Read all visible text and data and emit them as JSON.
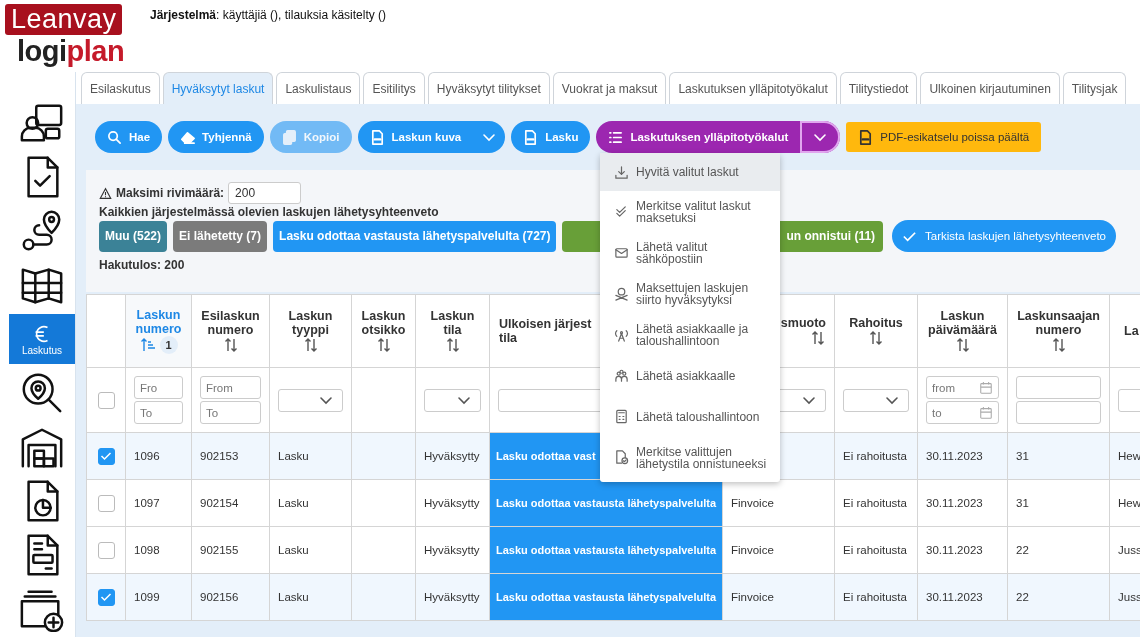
{
  "logo": {
    "brand": "Leanvay",
    "product_start": "logi",
    "product_end": "plan"
  },
  "header": {
    "text": "**Järjestelmä**: käyttäjiä (), tilauksia käsitelty ()"
  },
  "sidebar": {
    "items": [
      {
        "kind": "presenter",
        "selected": false
      },
      {
        "kind": "document-check",
        "selected": false
      },
      {
        "kind": "route",
        "selected": false
      },
      {
        "kind": "map",
        "selected": false
      },
      {
        "kind": "euro",
        "label": "Laskutus",
        "selected": true
      },
      {
        "kind": "search-pin",
        "selected": false
      },
      {
        "kind": "warehouse",
        "selected": false
      },
      {
        "kind": "document-chart",
        "selected": false
      },
      {
        "kind": "document-form",
        "selected": false
      },
      {
        "kind": "folder-plus",
        "selected": false
      }
    ]
  },
  "tabs": [
    {
      "label": "Esilaskutus",
      "selected": false
    },
    {
      "label": "Hyväksytyt laskut",
      "selected": true
    },
    {
      "label": "Laskulistaus",
      "selected": false
    },
    {
      "label": "Esitilitys",
      "selected": false
    },
    {
      "label": "Hyväksytyt tilitykset",
      "selected": false
    },
    {
      "label": "Vuokrat ja maksut",
      "selected": false
    },
    {
      "label": "Laskutuksen ylläpitotyökalut",
      "selected": false
    },
    {
      "label": "Tilitystiedot",
      "selected": false
    },
    {
      "label": "Ulkoinen kirjautuminen",
      "selected": false
    },
    {
      "label": "Tilitysjak",
      "selected": false
    }
  ],
  "toolbar": {
    "buttons": [
      {
        "label": "Hae",
        "kind": "search",
        "disabled": false
      },
      {
        "label": "Tyhjennä",
        "kind": "clear",
        "disabled": false
      },
      {
        "label": "Kopioi",
        "kind": "copy",
        "disabled": true
      },
      {
        "label": "Laskun kuva",
        "kind": "image",
        "disabled": false
      },
      {
        "label": "Lasku",
        "kind": "invoice",
        "disabled": false
      },
      {
        "label": "Laskutuksen ylläpitotyökalut",
        "kind": "tools",
        "disabled": false
      },
      {
        "label": "PDF-esikatselu poissa päältä",
        "kind": "preview",
        "disabled": false
      }
    ]
  },
  "menu": {
    "items": [
      {
        "label": "Hyvitä valitut laskut",
        "kind": "credit",
        "highlighted": true
      },
      {
        "label": "Merkitse valitut laskut maksetuksi",
        "kind": "mark-paid",
        "highlighted": false
      },
      {
        "label": "Lähetä valitut sähköpostiin",
        "kind": "email",
        "highlighted": false
      },
      {
        "label": "Maksettujen laskujen siirto hyväksytyksi",
        "kind": "transfer",
        "highlighted": false
      },
      {
        "label": "Lähetä asiakkaalle ja taloushallintoon",
        "kind": "send-both",
        "highlighted": false
      },
      {
        "label": "Lähetä asiakkaalle",
        "kind": "send-customer",
        "highlighted": false
      },
      {
        "label": "Lähetä taloushallintoon",
        "kind": "send-accounting",
        "highlighted": false
      },
      {
        "label": "Merkitse valittujen lähetystila onnistuneeksi",
        "kind": "mark-sent",
        "highlighted": false
      }
    ]
  },
  "filters": {
    "max_rows_label": "Maksimi rivimäärä:",
    "max_rows_value": "200",
    "summary_title": "Kaikkien järjestelmässä olevien laskujen lähetysyhteenveto",
    "summary_buttons": [
      {
        "label": "Muu (522)",
        "color": "#3b8297"
      },
      {
        "label": "Ei lähetetty (7)",
        "color": "#7b7b7b"
      },
      {
        "label": "Lasku odottaa vastausta lähetyspalvelulta (727)",
        "color": "#2196f3"
      },
      {
        "label": "un onnistui (11)",
        "color": "#689f38"
      }
    ],
    "check_button": "Tarkista laskujen lähetysyhteenveto",
    "result": "Hakutulos: 200"
  },
  "table": {
    "select_all": {
      "checked": false
    },
    "columns": [
      {
        "label": "Laskun numero",
        "sortable": true,
        "sorted": true,
        "sort_order": "1",
        "kind": "text",
        "filter": {
          "kind": "range",
          "placeholders": [
            "Fro",
            "To"
          ]
        }
      },
      {
        "label": "Esilaskun numero",
        "sortable": true,
        "sorted": false,
        "kind": "text",
        "filter": {
          "kind": "range",
          "placeholders": [
            "From",
            "To"
          ]
        }
      },
      {
        "label": "Laskun tyyppi",
        "sortable": true,
        "sorted": false,
        "kind": "text",
        "filter": {
          "kind": "select"
        }
      },
      {
        "label": "Laskun otsikko",
        "sortable": true,
        "sorted": false,
        "kind": "text",
        "filter": {
          "kind": "none"
        }
      },
      {
        "label": "Laskun tila",
        "sortable": true,
        "sorted": false,
        "kind": "text",
        "filter": {
          "kind": "select"
        }
      },
      {
        "label": "Ulkoisen järjest\ntila",
        "sortable": false,
        "sorted": false,
        "kind": "status",
        "filter": {
          "kind": "text"
        }
      },
      {
        "label": "smuoto",
        "sortable": true,
        "sorted": false,
        "kind": "text",
        "filter": {
          "kind": "select"
        }
      },
      {
        "label": "Rahoitus",
        "sortable": true,
        "sorted": false,
        "kind": "text",
        "filter": {
          "kind": "select"
        }
      },
      {
        "label": "Laskun päivämäärä",
        "sortable": true,
        "sorted": false,
        "kind": "text",
        "filter": {
          "kind": "date_range",
          "placeholders": [
            "from",
            "to"
          ]
        }
      },
      {
        "label": "Laskunsaajan numero",
        "sortable": true,
        "sorted": false,
        "kind": "text",
        "filter": {
          "kind": "text_pair"
        }
      },
      {
        "label": "La",
        "sortable": false,
        "sorted": false,
        "kind": "text",
        "filter": {
          "kind": "text"
        }
      }
    ],
    "rows": [
      {
        "checked": true,
        "cells": [
          "1096",
          "902153",
          "Lasku",
          null,
          "Hyväksytty",
          "Lasku odottaa vast",
          null,
          "Ei rahoitusta",
          "30.11.2023",
          "31",
          "Hew"
        ]
      },
      {
        "checked": false,
        "cells": [
          "1097",
          "902154",
          "Lasku",
          null,
          "Hyväksytty",
          "Lasku odottaa vastausta lähetyspalvelulta",
          "Finvoice",
          "Ei rahoitusta",
          "30.11.2023",
          "31",
          "Hew"
        ]
      },
      {
        "checked": false,
        "cells": [
          "1098",
          "902155",
          "Lasku",
          null,
          "Hyväksytty",
          "Lasku odottaa vastausta lähetyspalvelulta",
          "Finvoice",
          "Ei rahoitusta",
          "30.11.2023",
          "22",
          "Juss"
        ]
      },
      {
        "checked": true,
        "cells": [
          "1099",
          "902156",
          "Lasku",
          null,
          "Hyväksytty",
          "Lasku odottaa vastausta lähetyspalvelulta",
          "Finvoice",
          "Ei rahoitusta",
          "30.11.2023",
          "22",
          "Juss"
        ]
      }
    ]
  }
}
